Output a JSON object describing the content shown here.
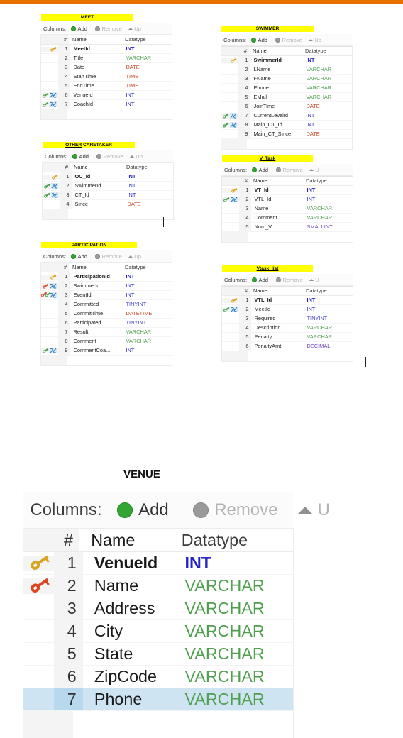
{
  "page": {
    "accent_bar_color": "#e57200",
    "highlight_color": "#ffff00",
    "selection_color": "#cfe4f2"
  },
  "toolbar": {
    "columns_label": "Columns:",
    "add_label": "Add",
    "remove_label": "Remove",
    "up_label": "Up",
    "up_label_clipped": "U",
    "up_label_clipped2": "Up",
    "add_icon": "plus-circle-icon",
    "remove_icon": "minus-circle-icon",
    "up_icon": "triangle-up-icon"
  },
  "grid_headers": {
    "num": "#",
    "name": "Name",
    "datatype": "Datatype"
  },
  "venue_section_label": "VENUE",
  "tables": [
    {
      "name": "MEET",
      "underline": "none",
      "columns": [
        {
          "num": "1",
          "name": "MeetId",
          "type": "INT",
          "pk": true,
          "icons": [
            "pk-gold-key-icon"
          ]
        },
        {
          "num": "2",
          "name": "Title",
          "type": "VARCHAR",
          "pk": false,
          "icons": []
        },
        {
          "num": "3",
          "name": "Date",
          "type": "DATE",
          "pk": false,
          "icons": []
        },
        {
          "num": "4",
          "name": "StartTime",
          "type": "TIME",
          "pk": false,
          "icons": []
        },
        {
          "num": "5",
          "name": "EndTime",
          "type": "TIME",
          "pk": false,
          "icons": []
        },
        {
          "num": "6",
          "name": "VenueId",
          "type": "INT",
          "pk": false,
          "icons": [
            "fk-green-key-icon",
            "index-blue-icon"
          ]
        },
        {
          "num": "7",
          "name": "CoachId",
          "type": "INT",
          "pk": false,
          "icons": [
            "fk-green-key-icon",
            "index-blue-icon"
          ]
        }
      ]
    },
    {
      "name": "SWIMMER",
      "underline": "none",
      "columns": [
        {
          "num": "1",
          "name": "SwimmerId",
          "type": "INT",
          "pk": true,
          "icons": [
            "pk-gold-key-icon"
          ]
        },
        {
          "num": "2",
          "name": "LName",
          "type": "VARCHAR",
          "pk": false,
          "icons": []
        },
        {
          "num": "3",
          "name": "FName",
          "type": "VARCHAR",
          "pk": false,
          "icons": []
        },
        {
          "num": "4",
          "name": "Phone",
          "type": "VARCHAR",
          "pk": false,
          "icons": []
        },
        {
          "num": "5",
          "name": "EMail",
          "type": "VARCHAR",
          "pk": false,
          "icons": []
        },
        {
          "num": "6",
          "name": "JoinTime",
          "type": "DATE",
          "pk": false,
          "icons": []
        },
        {
          "num": "7",
          "name": "CurrentLevelId",
          "type": "INT",
          "pk": false,
          "icons": [
            "fk-green-key-icon",
            "index-blue-icon"
          ]
        },
        {
          "num": "8",
          "name": "Main_CT_Id",
          "type": "INT",
          "pk": false,
          "icons": [
            "fk-green-key-icon",
            "index-blue-icon"
          ]
        },
        {
          "num": "9",
          "name": "Main_CT_Since",
          "type": "DATE",
          "pk": false,
          "icons": []
        }
      ]
    },
    {
      "name": "OTHER CARETAKER",
      "underline": "partial",
      "columns": [
        {
          "num": "1",
          "name": "OC_Id",
          "type": "INT",
          "pk": true,
          "icons": [
            "pk-gold-key-icon"
          ]
        },
        {
          "num": "2",
          "name": "SwimmerId",
          "type": "INT",
          "pk": false,
          "icons": [
            "fk-green-key-icon",
            "index-blue-icon"
          ]
        },
        {
          "num": "3",
          "name": "CT_Id",
          "type": "INT",
          "pk": false,
          "icons": [
            "fk-green-key-icon",
            "index-blue-icon"
          ]
        },
        {
          "num": "4",
          "name": "Since",
          "type": "DATE",
          "pk": false,
          "icons": []
        }
      ]
    },
    {
      "name": "V_Task",
      "underline": "full",
      "columns": [
        {
          "num": "1",
          "name": "VT_Id",
          "type": "INT",
          "pk": true,
          "icons": [
            "pk-gold-key-icon"
          ]
        },
        {
          "num": "2",
          "name": "VTL_Id",
          "type": "INT",
          "pk": false,
          "icons": [
            "fk-green-key-icon",
            "index-blue-icon"
          ]
        },
        {
          "num": "3",
          "name": "Name",
          "type": "VARCHAR",
          "pk": false,
          "icons": []
        },
        {
          "num": "4",
          "name": "Comment",
          "type": "VARCHAR",
          "pk": false,
          "icons": []
        },
        {
          "num": "5",
          "name": "Num_V",
          "type": "SMALLINT",
          "pk": false,
          "icons": []
        }
      ]
    },
    {
      "name": "PARTICIPATION",
      "underline": "none",
      "columns": [
        {
          "num": "1",
          "name": "ParticipationId",
          "type": "INT",
          "pk": true,
          "icons": [
            "pk-gold-key-icon"
          ]
        },
        {
          "num": "2",
          "name": "SwimmerId",
          "type": "INT",
          "pk": false,
          "icons": [
            "pk-red-key-icon",
            "index-blue-icon"
          ]
        },
        {
          "num": "3",
          "name": "EventId",
          "type": "INT",
          "pk": false,
          "icons": [
            "pk-red-key-icon",
            "fk-green-key-icon",
            "index-blue-icon"
          ]
        },
        {
          "num": "4",
          "name": "Committed",
          "type": "TINYINT",
          "pk": false,
          "icons": []
        },
        {
          "num": "5",
          "name": "CommitTime",
          "type": "DATETIME",
          "pk": false,
          "icons": []
        },
        {
          "num": "6",
          "name": "Participated",
          "type": "TINYINT",
          "pk": false,
          "icons": []
        },
        {
          "num": "7",
          "name": "Result",
          "type": "VARCHAR",
          "pk": false,
          "icons": []
        },
        {
          "num": "8",
          "name": "Comment",
          "type": "VARCHAR",
          "pk": false,
          "icons": []
        },
        {
          "num": "9",
          "name": "CommentCoa...",
          "type": "INT",
          "pk": false,
          "icons": [
            "fk-green-key-icon",
            "index-blue-icon"
          ]
        }
      ]
    },
    {
      "name": "Vtask_list",
      "underline": "full",
      "columns": [
        {
          "num": "1",
          "name": "VTL_Id",
          "type": "INT",
          "pk": true,
          "icons": [
            "pk-gold-key-icon"
          ]
        },
        {
          "num": "2",
          "name": "MeetId",
          "type": "INT",
          "pk": false,
          "icons": [
            "fk-green-key-icon",
            "index-blue-icon"
          ]
        },
        {
          "num": "3",
          "name": "Required",
          "type": "TINYINT",
          "pk": false,
          "icons": []
        },
        {
          "num": "4",
          "name": "Description",
          "type": "VARCHAR",
          "pk": false,
          "icons": []
        },
        {
          "num": "5",
          "name": "Penalty",
          "type": "VARCHAR",
          "pk": false,
          "icons": []
        },
        {
          "num": "6",
          "name": "PenaltyAmt",
          "type": "DECIMAL",
          "pk": false,
          "icons": []
        }
      ]
    }
  ],
  "venue_table": {
    "name": "VENUE",
    "columns": [
      {
        "num": "1",
        "name": "VenueId",
        "type": "INT",
        "pk": true,
        "selected": false,
        "icons": [
          "pk-gold-key-icon"
        ]
      },
      {
        "num": "2",
        "name": "Name",
        "type": "VARCHAR",
        "pk": false,
        "selected": false,
        "icons": [
          "pk-red-key-icon"
        ]
      },
      {
        "num": "3",
        "name": "Address",
        "type": "VARCHAR",
        "pk": false,
        "selected": false,
        "icons": []
      },
      {
        "num": "4",
        "name": "City",
        "type": "VARCHAR",
        "pk": false,
        "selected": false,
        "icons": []
      },
      {
        "num": "5",
        "name": "State",
        "type": "VARCHAR",
        "pk": false,
        "selected": false,
        "icons": []
      },
      {
        "num": "6",
        "name": "ZipCode",
        "type": "VARCHAR",
        "pk": false,
        "selected": false,
        "icons": []
      },
      {
        "num": "7",
        "name": "Phone",
        "type": "VARCHAR",
        "pk": false,
        "selected": true,
        "icons": []
      }
    ]
  }
}
